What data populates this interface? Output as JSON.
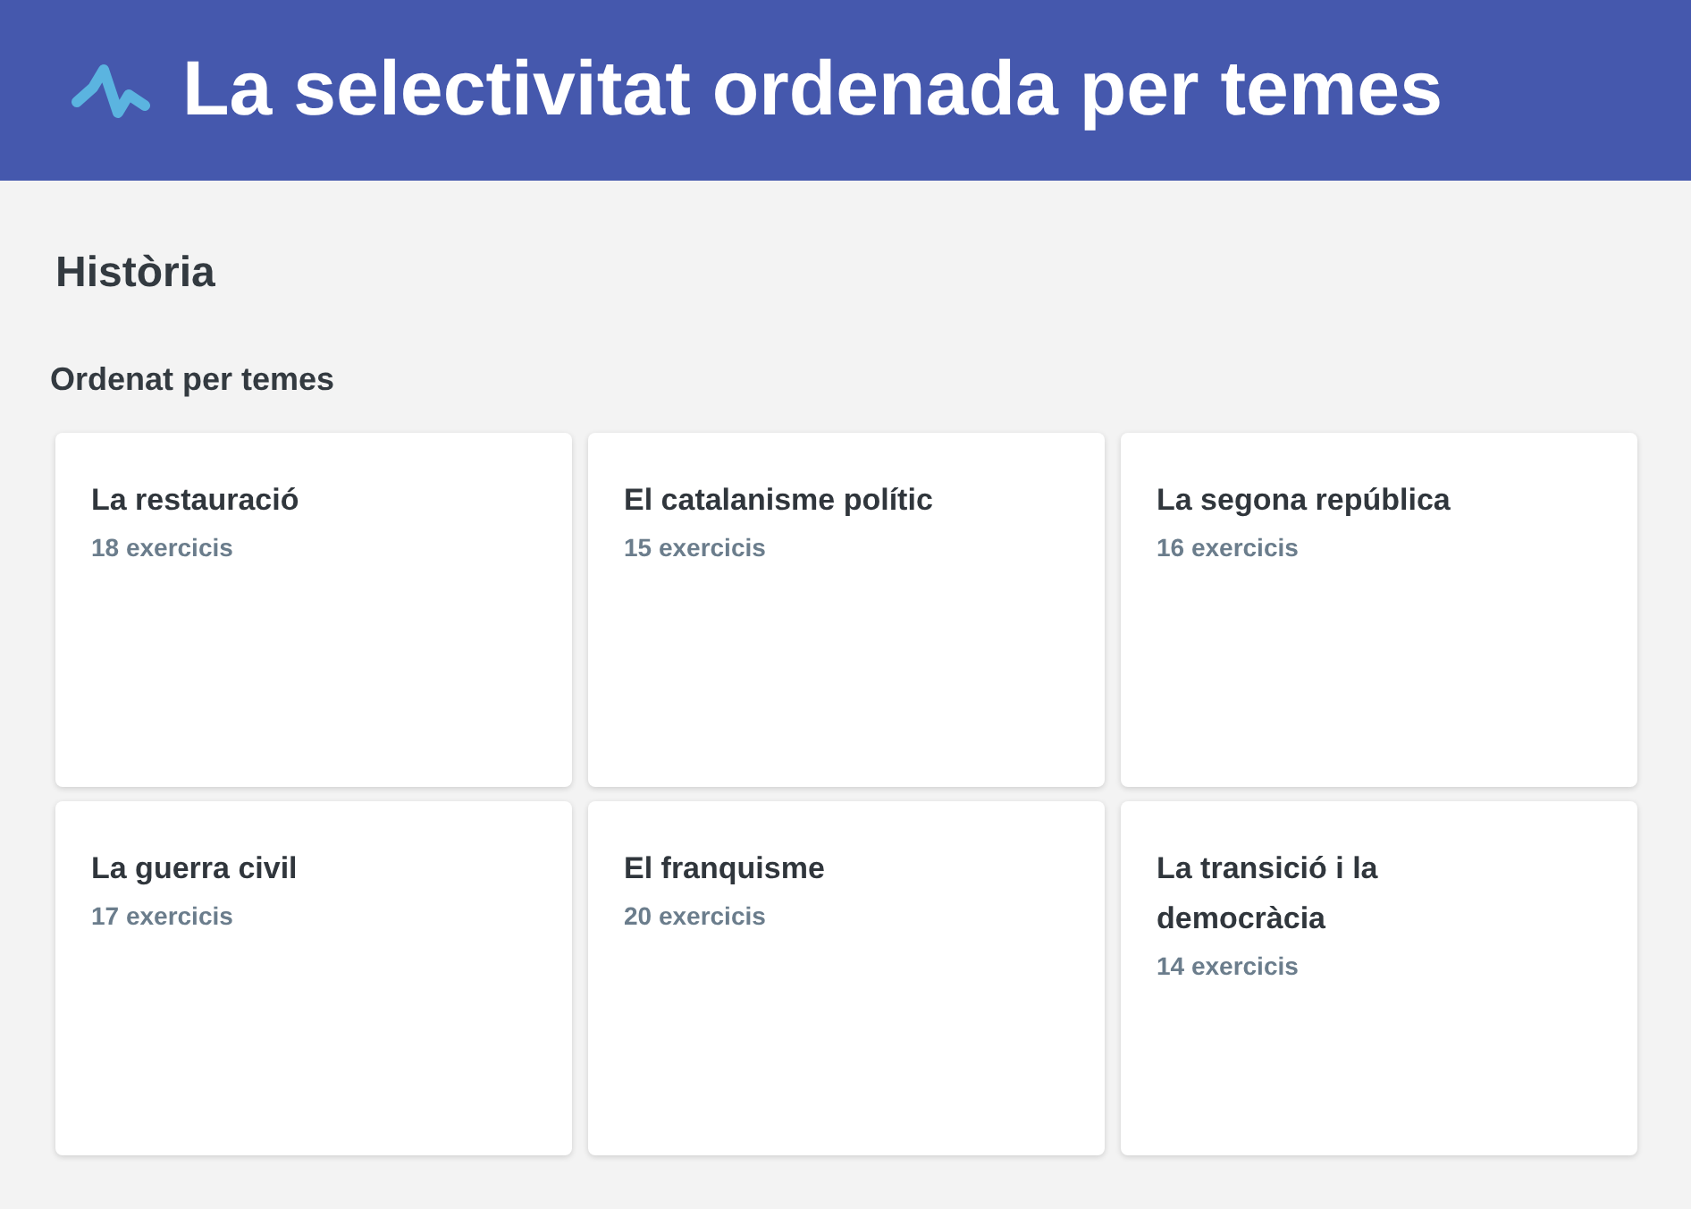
{
  "header": {
    "title": "La selectivitat ordenada per temes"
  },
  "subject": "Història",
  "section": {
    "title": "Ordenat per temes",
    "topics": [
      {
        "title": "La restauració",
        "count": "18 exercicis"
      },
      {
        "title": "El catalanisme polític",
        "count": "15 exercicis"
      },
      {
        "title": "La segona república",
        "count": "16 exercicis"
      },
      {
        "title": "La guerra civil",
        "count": "17 exercicis"
      },
      {
        "title": "El franquisme",
        "count": "20 exercicis"
      },
      {
        "title": "La transició i la democràcia",
        "count": "14 exercicis"
      }
    ]
  }
}
